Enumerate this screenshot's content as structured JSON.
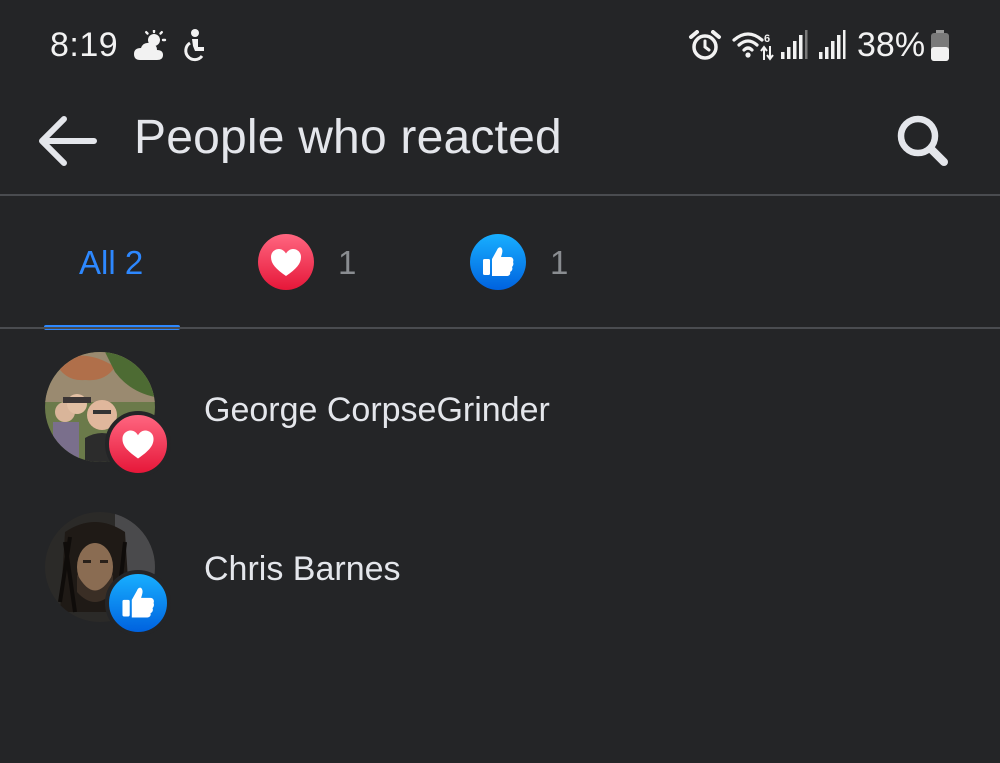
{
  "status_bar": {
    "time": "8:19",
    "battery_percent": "38%",
    "icons": [
      "weather-sun-cloud-icon",
      "accessibility-icon",
      "alarm-icon",
      "wifi-icon",
      "signal-icon",
      "signal-icon",
      "battery-icon"
    ]
  },
  "header": {
    "title": "People who reacted",
    "back_icon": "arrow-left-icon",
    "search_icon": "search-icon"
  },
  "tabs": [
    {
      "label": "All 2",
      "selected": true
    },
    {
      "reaction": "love",
      "count": "1",
      "icon": "heart-icon",
      "color": "#f33e58"
    },
    {
      "reaction": "like",
      "count": "1",
      "icon": "thumbs-up-icon",
      "color": "#1877f2"
    }
  ],
  "people": [
    {
      "name": "George CorpseGrinder",
      "reaction": "love",
      "badge_icon": "heart-icon"
    },
    {
      "name": "Chris Barnes",
      "reaction": "like",
      "badge_icon": "thumbs-up-icon"
    }
  ],
  "colors": {
    "background": "#242527",
    "accent": "#2d88ff",
    "divider": "#4a4c50",
    "love": "#f33e58",
    "like": "#1877f2"
  }
}
